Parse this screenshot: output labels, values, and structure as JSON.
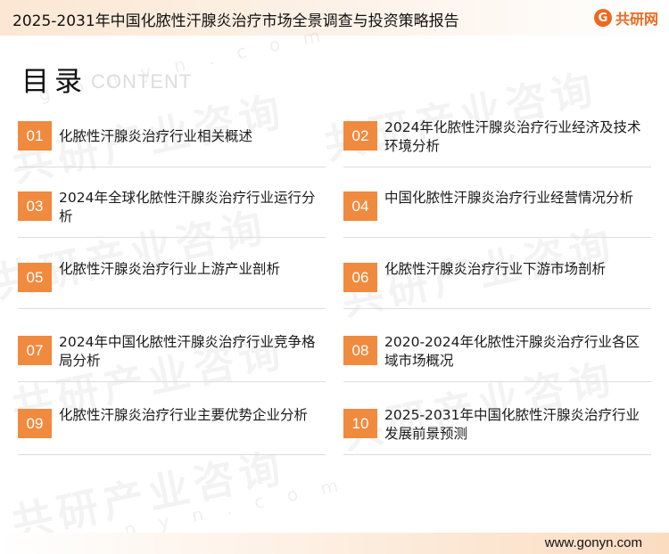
{
  "header": {
    "title": "2025-2031年中国化脓性汗腺炎治疗市场全景调查与投资策略报告",
    "logo_text": "共研网",
    "logo_icon": "G"
  },
  "toc": {
    "title": "目录",
    "subtitle": "CONTENT"
  },
  "watermarks": {
    "brand": "共研产业咨询",
    "domain": "g o n y n . c o m"
  },
  "items": [
    {
      "num": "01",
      "text": "化脓性汗腺炎治疗行业相关概述"
    },
    {
      "num": "02",
      "text": "2024年化脓性汗腺炎治疗行业经济及技术环境分析"
    },
    {
      "num": "03",
      "text": "2024年全球化脓性汗腺炎治疗行业运行分析"
    },
    {
      "num": "04",
      "text": "中国化脓性汗腺炎治疗行业经营情况分析"
    },
    {
      "num": "05",
      "text": "化脓性汗腺炎治疗行业上游产业剖析"
    },
    {
      "num": "06",
      "text": "化脓性汗腺炎治疗行业下游市场剖析"
    },
    {
      "num": "07",
      "text": "2024年中国化脓性汗腺炎治疗行业竞争格局分析"
    },
    {
      "num": "08",
      "text": "2020-2024年化脓性汗腺炎治疗行业各区域市场概况"
    },
    {
      "num": "09",
      "text": "化脓性汗腺炎治疗行业主要优势企业分析"
    },
    {
      "num": "10",
      "text": "2025-2031年中国化脓性汗腺炎治疗行业发展前景预测"
    }
  ],
  "footer": {
    "url": "www.gonyn.com"
  },
  "colors": {
    "accent": "#f08a3f",
    "brand": "#ec6a1f"
  }
}
